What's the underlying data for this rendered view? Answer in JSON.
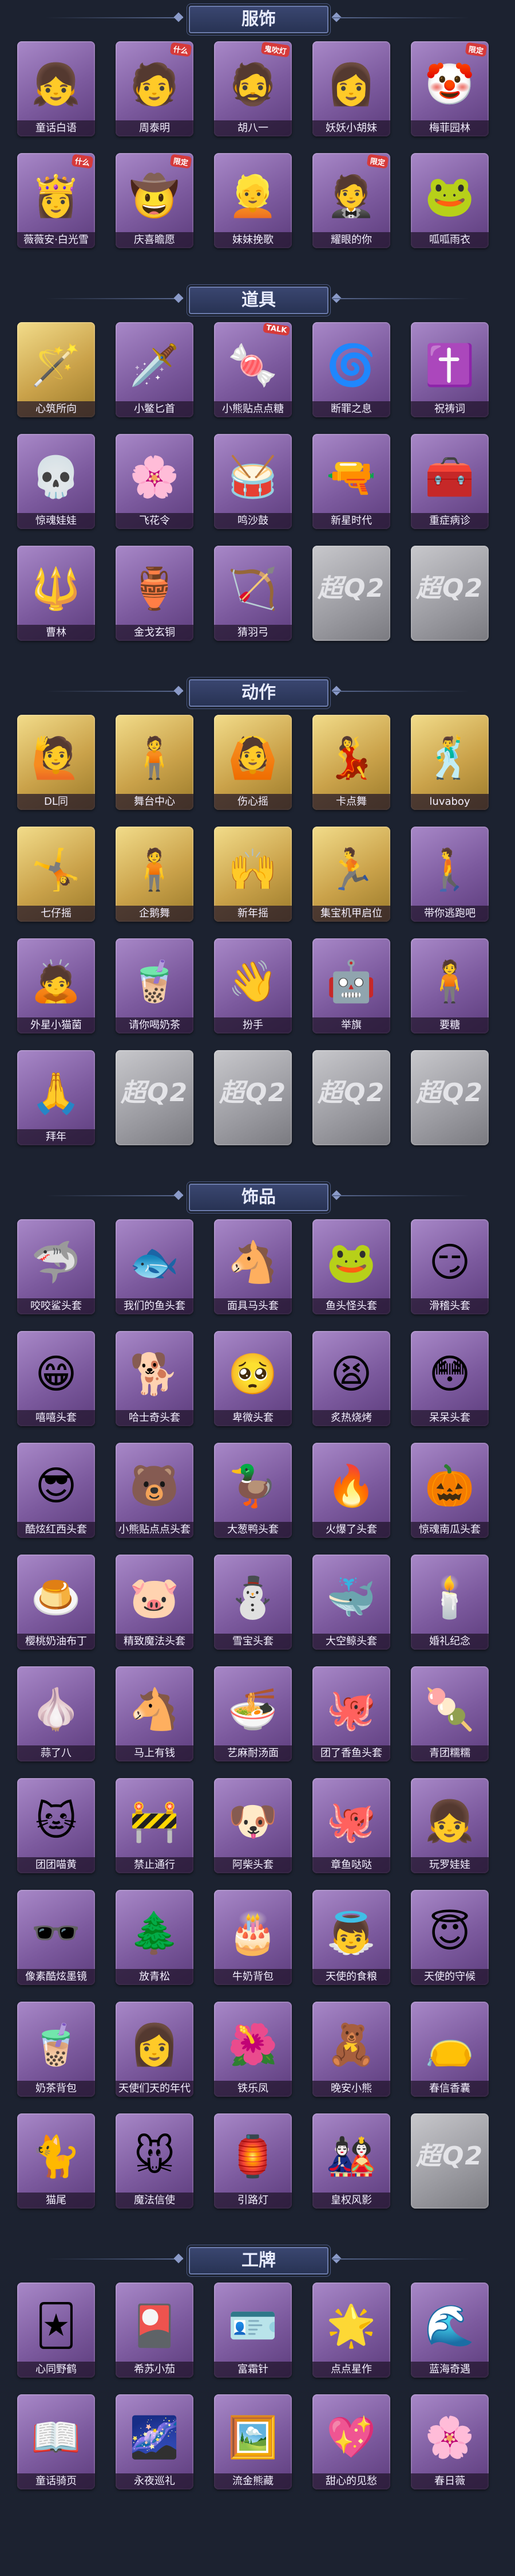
{
  "sections": [
    {
      "title": "服饰",
      "items": [
        {
          "label": "童话白语",
          "glyph": "👧",
          "tone": "purple"
        },
        {
          "label": "周泰明",
          "glyph": "🧑",
          "tone": "purple",
          "badge": "什么"
        },
        {
          "label": "胡八一",
          "glyph": "🧔",
          "tone": "purple",
          "badge": "鬼吹灯"
        },
        {
          "label": "妖妖小胡妹",
          "glyph": "👩",
          "tone": "purple"
        },
        {
          "label": "梅菲园林",
          "glyph": "🤡",
          "tone": "purple",
          "badge": "限定"
        },
        {
          "label": "薇薇安·白光雪",
          "glyph": "👸",
          "tone": "purple",
          "badge": "什么"
        },
        {
          "label": "庆喜瞻愿",
          "glyph": "🤠",
          "tone": "purple",
          "badge": "限定"
        },
        {
          "label": "妹妹挽歌",
          "glyph": "👱",
          "tone": "purple"
        },
        {
          "label": "耀眼的你",
          "glyph": "🤵",
          "tone": "purple",
          "badge": "限定"
        },
        {
          "label": "呱呱雨衣",
          "glyph": "🐸",
          "tone": "purple"
        }
      ]
    },
    {
      "title": "道具",
      "items": [
        {
          "label": "心筑所向",
          "glyph": "🪄",
          "tone": "gold"
        },
        {
          "label": "小鳖匕首",
          "glyph": "🗡️",
          "tone": "purple"
        },
        {
          "label": "小熊贴点点糖",
          "glyph": "🍬",
          "tone": "purple",
          "badge": "TALK"
        },
        {
          "label": "断罪之息",
          "glyph": "🌀",
          "tone": "purple"
        },
        {
          "label": "祝祷词",
          "glyph": "✝️",
          "tone": "purple"
        },
        {
          "label": "惊魂娃娃",
          "glyph": "💀",
          "tone": "purple"
        },
        {
          "label": "飞花令",
          "glyph": "🌸",
          "tone": "purple"
        },
        {
          "label": "鸣沙鼓",
          "glyph": "🥁",
          "tone": "purple"
        },
        {
          "label": "新星时代",
          "glyph": "🔫",
          "tone": "purple"
        },
        {
          "label": "重症病诊",
          "glyph": "🧰",
          "tone": "purple"
        },
        {
          "label": "曹林",
          "glyph": "🔱",
          "tone": "purple"
        },
        {
          "label": "金戈玄铜",
          "glyph": "🏺",
          "tone": "purple"
        },
        {
          "label": "猜羽弓",
          "glyph": "🏹",
          "tone": "purple"
        },
        {
          "label": "",
          "glyph": "超Q2",
          "tone": "locked"
        },
        {
          "label": "",
          "glyph": "超Q2",
          "tone": "locked"
        }
      ]
    },
    {
      "title": "动作",
      "items": [
        {
          "label": "DL同",
          "glyph": "🙋",
          "tone": "gold"
        },
        {
          "label": "舞台中心",
          "glyph": "🧍",
          "tone": "gold"
        },
        {
          "label": "伤心摇",
          "glyph": "🙆",
          "tone": "gold"
        },
        {
          "label": "卡点舞",
          "glyph": "💃",
          "tone": "gold"
        },
        {
          "label": "luvaboy",
          "glyph": "🕺",
          "tone": "gold"
        },
        {
          "label": "七仔摇",
          "glyph": "🤸",
          "tone": "gold"
        },
        {
          "label": "企鹅舞",
          "glyph": "🧍",
          "tone": "gold"
        },
        {
          "label": "新年摇",
          "glyph": "🙌",
          "tone": "gold"
        },
        {
          "label": "集宝机甲启位",
          "glyph": "🏃",
          "tone": "gold"
        },
        {
          "label": "带你逃跑吧",
          "glyph": "🚶",
          "tone": "purple"
        },
        {
          "label": "外星小猫菌",
          "glyph": "🙇",
          "tone": "purple"
        },
        {
          "label": "请你喝奶茶",
          "glyph": "🧋",
          "tone": "purple"
        },
        {
          "label": "扮手",
          "glyph": "👋",
          "tone": "purple"
        },
        {
          "label": "举旗",
          "glyph": "🤖",
          "tone": "purple"
        },
        {
          "label": "要糖",
          "glyph": "🧍",
          "tone": "purple"
        },
        {
          "label": "拜年",
          "glyph": "🙏",
          "tone": "purple"
        },
        {
          "label": "",
          "glyph": "超Q2",
          "tone": "locked"
        },
        {
          "label": "",
          "glyph": "超Q2",
          "tone": "locked"
        },
        {
          "label": "",
          "glyph": "超Q2",
          "tone": "locked"
        },
        {
          "label": "",
          "glyph": "超Q2",
          "tone": "locked"
        }
      ]
    },
    {
      "title": "饰品",
      "items": [
        {
          "label": "咬咬鲨头套",
          "glyph": "🦈",
          "tone": "purple"
        },
        {
          "label": "我们的鱼头套",
          "glyph": "🐟",
          "tone": "purple"
        },
        {
          "label": "面具马头套",
          "glyph": "🐴",
          "tone": "purple"
        },
        {
          "label": "鱼头怪头套",
          "glyph": "🐸",
          "tone": "purple"
        },
        {
          "label": "滑稽头套",
          "glyph": "😏",
          "tone": "purple"
        },
        {
          "label": "嘻嘻头套",
          "glyph": "😁",
          "tone": "purple"
        },
        {
          "label": "哈士奇头套",
          "glyph": "🐕",
          "tone": "purple"
        },
        {
          "label": "卑微头套",
          "glyph": "🥺",
          "tone": "purple"
        },
        {
          "label": "炙热烧烤",
          "glyph": "😫",
          "tone": "purple"
        },
        {
          "label": "呆呆头套",
          "glyph": "😳",
          "tone": "purple"
        },
        {
          "label": "酷炫红西头套",
          "glyph": "😎",
          "tone": "purple"
        },
        {
          "label": "小熊贴点点头套",
          "glyph": "🐻",
          "tone": "purple"
        },
        {
          "label": "大葱鸭头套",
          "glyph": "🦆",
          "tone": "purple"
        },
        {
          "label": "火爆了头套",
          "glyph": "🔥",
          "tone": "purple"
        },
        {
          "label": "惊魂南瓜头套",
          "glyph": "🎃",
          "tone": "purple"
        },
        {
          "label": "樱桃奶油布丁",
          "glyph": "🍮",
          "tone": "purple"
        },
        {
          "label": "精致魔法头套",
          "glyph": "🐷",
          "tone": "purple"
        },
        {
          "label": "雪宝头套",
          "glyph": "⛄",
          "tone": "purple"
        },
        {
          "label": "大空鲸头套",
          "glyph": "🐳",
          "tone": "purple"
        },
        {
          "label": "婚礼纪念",
          "glyph": "🕯️",
          "tone": "purple"
        },
        {
          "label": "蒜了八",
          "glyph": "🧄",
          "tone": "purple"
        },
        {
          "label": "马上有钱",
          "glyph": "🐴",
          "tone": "purple"
        },
        {
          "label": "艺麻耐汤面",
          "glyph": "🍜",
          "tone": "purple"
        },
        {
          "label": "团了香鱼头套",
          "glyph": "🐙",
          "tone": "purple"
        },
        {
          "label": "青团糯糯",
          "glyph": "🍡",
          "tone": "purple"
        },
        {
          "label": "团团喵黄",
          "glyph": "🐱",
          "tone": "purple"
        },
        {
          "label": "禁止通行",
          "glyph": "🚧",
          "tone": "purple"
        },
        {
          "label": "阿柴头套",
          "glyph": "🐶",
          "tone": "purple"
        },
        {
          "label": "章鱼哒哒",
          "glyph": "🐙",
          "tone": "purple"
        },
        {
          "label": "玩罗娃娃",
          "glyph": "👧",
          "tone": "purple"
        },
        {
          "label": "像素酷炫墨镜",
          "glyph": "🕶️",
          "tone": "purple"
        },
        {
          "label": "放青松",
          "glyph": "🌲",
          "tone": "purple"
        },
        {
          "label": "牛奶背包",
          "glyph": "🎂",
          "tone": "purple"
        },
        {
          "label": "天使的食粮",
          "glyph": "👼",
          "tone": "purple"
        },
        {
          "label": "天使的守候",
          "glyph": "😇",
          "tone": "purple"
        },
        {
          "label": "奶茶背包",
          "glyph": "🧋",
          "tone": "purple"
        },
        {
          "label": "天使们天的年代",
          "glyph": "👩",
          "tone": "purple"
        },
        {
          "label": "铁乐凤",
          "glyph": "🌺",
          "tone": "purple"
        },
        {
          "label": "晚安小熊",
          "glyph": "🧸",
          "tone": "purple"
        },
        {
          "label": "春信香囊",
          "glyph": "👝",
          "tone": "purple"
        },
        {
          "label": "猫尾",
          "glyph": "🐈",
          "tone": "purple"
        },
        {
          "label": "魔法信使",
          "glyph": "🐭",
          "tone": "purple"
        },
        {
          "label": "引路灯",
          "glyph": "🏮",
          "tone": "purple"
        },
        {
          "label": "皇权风影",
          "glyph": "🎎",
          "tone": "purple"
        },
        {
          "label": "",
          "glyph": "超Q2",
          "tone": "locked"
        }
      ]
    },
    {
      "title": "工牌",
      "items": [
        {
          "label": "心同野鹤",
          "glyph": "🃏",
          "tone": "purple"
        },
        {
          "label": "希苏小茄",
          "glyph": "🎴",
          "tone": "purple"
        },
        {
          "label": "富霜针",
          "glyph": "🪪",
          "tone": "purple"
        },
        {
          "label": "点点星作",
          "glyph": "🌟",
          "tone": "purple"
        },
        {
          "label": "蓝海奇遇",
          "glyph": "🌊",
          "tone": "purple"
        },
        {
          "label": "童话骑页",
          "glyph": "📖",
          "tone": "purple"
        },
        {
          "label": "永夜巡礼",
          "glyph": "🌌",
          "tone": "purple"
        },
        {
          "label": "流金熊藏",
          "glyph": "🖼️",
          "tone": "purple"
        },
        {
          "label": "甜心的见愁",
          "glyph": "💖",
          "tone": "purple"
        },
        {
          "label": "春日薇",
          "glyph": "🌸",
          "tone": "purple"
        }
      ]
    }
  ]
}
